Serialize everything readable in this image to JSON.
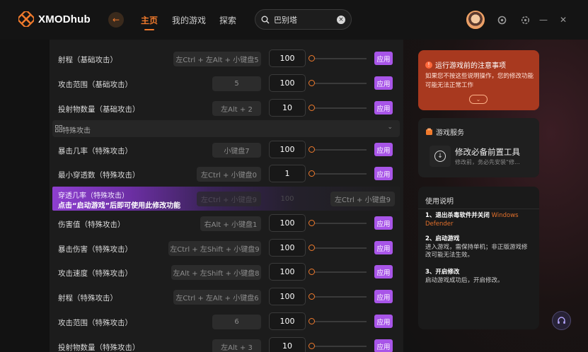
{
  "app": {
    "brand": "XMODhub"
  },
  "nav": {
    "home": "主页",
    "my_games": "我的游戏",
    "explore": "探索"
  },
  "search": {
    "value": "巴别塔"
  },
  "section": {
    "label": "特殊攻击"
  },
  "rows_top": [
    {
      "label": "射程（基础攻击）",
      "hotkey": "左Ctrl + 左Alt + 小键盘5",
      "value": "100"
    },
    {
      "label": "攻击范围（基础攻击）",
      "hotkey": "5",
      "value": "100"
    },
    {
      "label": "投射物数量（基础攻击）",
      "hotkey": "左Alt + 2",
      "value": "10"
    }
  ],
  "rows_special": [
    {
      "label": "暴击几率（特殊攻击）",
      "hotkey": "小键盘7",
      "value": "100"
    },
    {
      "label": "最小穿透数（特殊攻击）",
      "hotkey": "左Ctrl + 小键盘0",
      "value": "1"
    }
  ],
  "notice": {
    "label": "穿透几率（特殊攻击）",
    "hint": "点击“启动游戏”后即可使用此修改功能",
    "ghost_hotkey": "左Ctrl + 小键盘9",
    "ghost_value": "100",
    "hotkey": "左Ctrl + 小键盘9"
  },
  "rows_bottom": [
    {
      "label": "伤害值（特殊攻击）",
      "hotkey": "右Alt + 小键盘1",
      "value": "100"
    },
    {
      "label": "暴击伤害（特殊攻击）",
      "hotkey": "左Ctrl + 左Shift + 小键盘9",
      "value": "100"
    },
    {
      "label": "攻击速度（特殊攻击）",
      "hotkey": "左Alt + 左Shift + 小键盘8",
      "value": "100"
    },
    {
      "label": "射程（特殊攻击）",
      "hotkey": "左Ctrl + 左Alt + 小键盘6",
      "value": "100"
    },
    {
      "label": "攻击范围（特殊攻击）",
      "hotkey": "6",
      "value": "100"
    },
    {
      "label": "投射物数量（特殊攻击）",
      "hotkey": "左Alt + 3",
      "value": "10"
    }
  ],
  "apply_label": "应用",
  "warning": {
    "title": "运行游戏前的注意事项",
    "body": "如果您不按这些说明操作，您的修改功能可能无法正常工作"
  },
  "service": {
    "title": "游戏服务",
    "item_title": "修改必备前置工具",
    "item_desc": "修改前，务必先安装“修..."
  },
  "help": {
    "title": "使用说明",
    "s1_title": "1、退出杀毒软件并关闭",
    "s1_highlight": "Windows Defender",
    "s2_title": "2、启动游戏",
    "s2_body": "进入游戏，需保持单机；非正版游戏修改可能无法生效。",
    "s3_title": "3、开启修改",
    "s3_body": "启动游戏成功后，开启修改。"
  },
  "colors": {
    "accent": "#f07a2c",
    "apply": "#a855e8",
    "warning_bg": "#a8391f"
  }
}
